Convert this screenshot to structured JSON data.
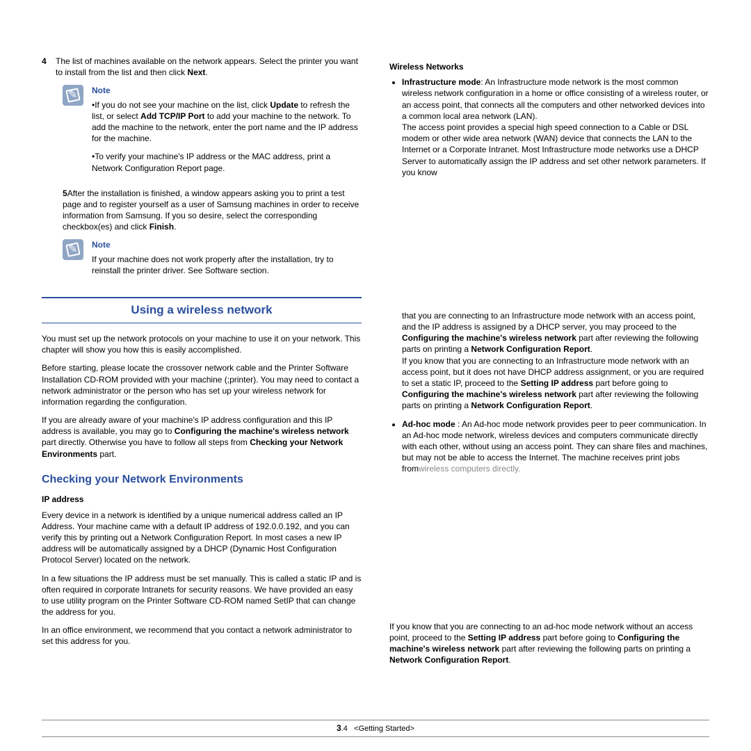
{
  "left": {
    "step4_num": "4",
    "step4": "The list of machines available on the network appears. Select the printer you want to install from the list and then click ",
    "next": "Next",
    "note1_label": "Note",
    "note1_a_pre": "•If you do not see your machine on the list, click ",
    "update": "Update",
    "note1_a_mid": " to refresh the list, or select ",
    "addport": "Add TCP/IP Port",
    "note1_a_post": " to add your machine to the network. To add the machine to the network, enter the port name and the IP address for the machine.",
    "note1_b": "•To verify your machine's IP address or the MAC address, print a Network Configuration Report page.",
    "step5_num": "5",
    "step5_a": "After the installation is finished, a window appears asking you to print a test page and to register yourself as a user of Samsung machines in order to receive information from Samsung. If you so desire, select the corresponding checkbox(es) and click ",
    "finish": "Finish",
    "note2_label": "Note",
    "note2": "If your machine does not work properly after the installation, try to reinstall the printer driver. See Software section.",
    "section": "Using a wireless network",
    "p1": "You must set up the network protocols on your machine to use it on your network.  This chapter will show you how this is easily accomplished.",
    "p2": "Before starting, please locate the crossover network cable and the Printer Software Installation CD-ROM provided with your machine (;printer). You may need to contact a network administrator or the person who has set up your wireless network for information regarding the configuration.",
    "p3_a": "If you are already aware of your machine's IP address configuration and this IP address is available, you may go to ",
    "p3_b1": "Configuring the machine's wireless network",
    "p3_mid": " part directly. Otherwise you have to follow all steps from ",
    "p3_b2": "Checking your Network Environments",
    "p3_end": " part.",
    "subhead": "Checking your Network Environments",
    "topic1": "IP address",
    "ip1": "Every device in a network is identified by a unique numerical address called an IP Address. Your machine came with a default IP address of 192.0.0.192, and you can verify this by printing out a Network Configuration Report. In most cases a new IP address will be automatically assigned by a DHCP (Dynamic Host Configuration Protocol Server) located on the network.",
    "ip2": "In a few situations the IP address must be set manually.  This is called a static IP and is often required in corporate Intranets for security reasons. We have provided an easy to use utility program on the Printer Software CD-ROM named SetIP that can change the address for you.",
    "ip3": "In an office environment, we recommend that you contact a network administrator to set this address for you."
  },
  "right": {
    "topic": "Wireless Networks",
    "infra_label": "Infrastructure mode",
    "infra_1": ": An Infrastructure mode network is the most common wireless network configuration in a home or office consisting of a wireless router, or an access point, that connects all the computers and other networked devices into a common local area network (LAN).",
    "infra_2": "The access point provides a special high speed connection to a Cable or DSL modem or other wide area network (WAN) device that connects the LAN to the Internet or a Corporate Intranet.  Most Infrastructure mode networks use a DHCP Server to automatically assign the IP address and set other network parameters. If you know",
    "cont1_a": "that you are connecting to an Infrastructure mode network with an access point, and the IP address is assigned by a DHCP server, you may proceed to the ",
    "cont1_b1": "Configuring the machine's wireless network",
    "cont1_mid1": " part after reviewing the following parts on printing a ",
    "cont1_b2": "Network Configuration Report",
    "cont1_end": ".",
    "cont2_a": "If you know that you are connecting to an Infrastructure mode network with an access point, but it does not have DHCP address assignment, or you are required to set a static IP, proceed to the ",
    "cont2_b1": "Setting IP address",
    "cont2_mid1": " part before going to ",
    "cont2_b2": "Configuring the machine's wireless network",
    "cont2_mid2": " part after reviewing the following parts on printing a ",
    "cont2_b3": "Network Configuration Report",
    "adhoc_label": "Ad-hoc mode",
    "adhoc_1": " : An Ad-hoc mode network provides peer to peer communication. In an Ad-hoc mode network, wireless devices and computers communicate directly with each other, without using an access point. They can share files and machines, but may not be able to access the Internet. The machine receives print jobs from",
    "adhoc_tail": "wireless computers directly.",
    "final_a": "If you know that you are connecting to an ad-hoc mode network without an access point, proceed to the ",
    "final_b1": "Setting IP address",
    "final_mid1": " part before going to ",
    "final_b2": "Configuring the machine's wireless network",
    "final_mid2": " part after reviewing the following parts on printing a ",
    "final_b3": "Network Configuration Report",
    "final_end": "."
  },
  "footer": {
    "chapter": "3",
    "page": ".4",
    "section": "<Getting Started>"
  }
}
